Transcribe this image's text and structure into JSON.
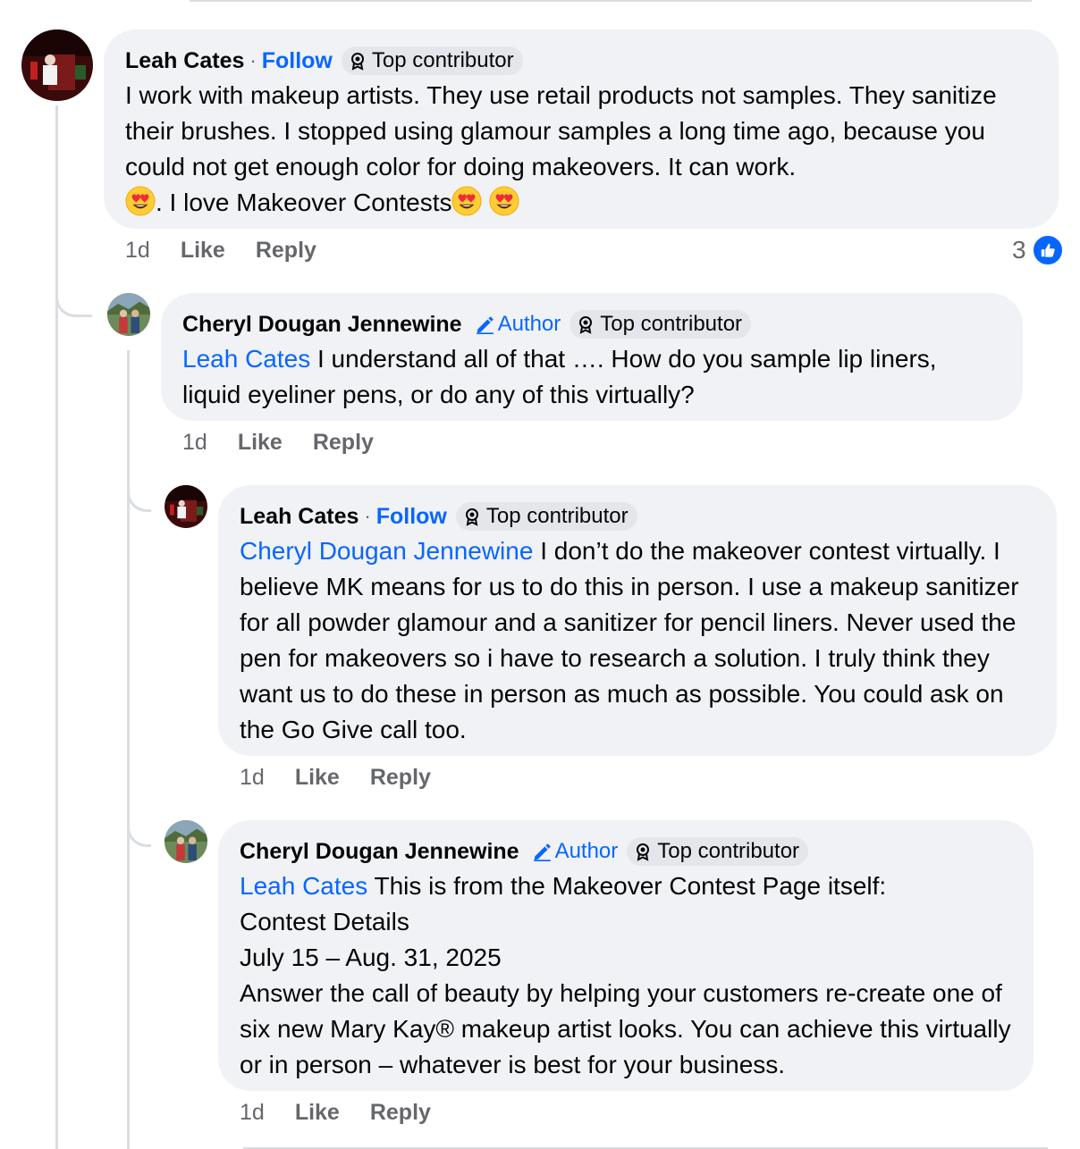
{
  "comments": [
    {
      "author": "Leah Cates",
      "separator": "·",
      "follow_label": "Follow",
      "badge": "Top contributor",
      "badge_icon": "award-icon",
      "text": "I work with makeup artists.  They use retail products not samples.  They sanitize their brushes.  I stopped using glamour samples a long time ago, because you could not get enough color for doing makeovers.  It can work.",
      "text_tail": ". I love Makeover Contests",
      "emoji": "heart-eyes-emoji",
      "time": "1d",
      "like_label": "Like",
      "reply_label": "Reply",
      "reaction_count": "3",
      "reaction_icon": "thumbs-up-icon"
    },
    {
      "author": "Cheryl Dougan Jennewine",
      "author_label": "Author",
      "badge": "Top contributor",
      "mention": "Leah Cates",
      "text": " I understand all of that …. How do you sample lip liners, liquid eyeliner pens, or do any of this virtually?",
      "time": "1d",
      "like_label": "Like",
      "reply_label": "Reply"
    },
    {
      "author": "Leah Cates",
      "separator": "·",
      "follow_label": "Follow",
      "badge": "Top contributor",
      "mention": "Cheryl Dougan Jennewine",
      "text": " I don’t do the makeover contest virtually.  I believe MK means for us to do this in person. I use a makeup sanitizer for all powder glamour and a sanitizer for pencil liners.  Never used the pen for makeovers so i have to research a solution. I truly think they want us to do these in person as much as possible.  You could ask on the Go Give call too.",
      "time": "1d",
      "like_label": "Like",
      "reply_label": "Reply"
    },
    {
      "author": "Cheryl Dougan Jennewine",
      "author_label": "Author",
      "badge": "Top contributor",
      "mention": "Leah Cates",
      "text_line1": " This is from the Makeover Contest Page itself:",
      "text_line2": "Contest Details",
      "text_line3": "July 15 – Aug. 31, 2025",
      "text_line4": "Answer the call of beauty by helping your customers re-create one of six new Mary Kay® makeup artist looks. You can achieve this virtually or in person – whatever is best for your business.",
      "time": "1d",
      "like_label": "Like",
      "reply_label": "Reply"
    }
  ],
  "colors": {
    "link_blue": "#0866ff",
    "bubble_bg": "#f0f2f5",
    "meta_gray": "#65676b",
    "badge_bg": "#e4e6eb"
  }
}
